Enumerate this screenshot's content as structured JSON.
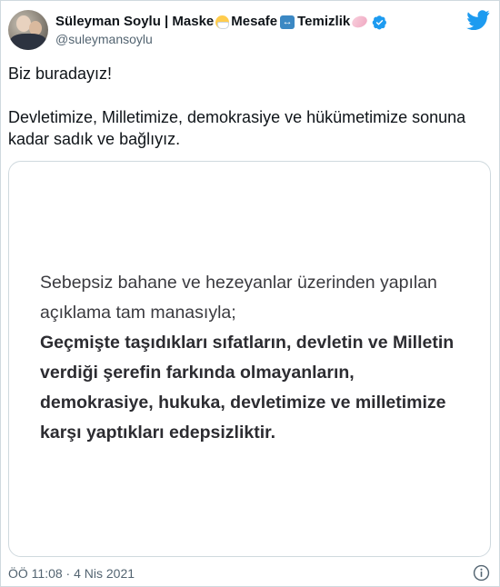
{
  "author": {
    "name_parts": [
      "Süleyman Soylu | Maske",
      "Mesafe",
      "Temizlik"
    ],
    "emoji": [
      "face-with-medical-mask",
      "left-right-arrow",
      "soap"
    ],
    "verified": true,
    "handle": "@suleymansoylu"
  },
  "brand": {
    "icon": "twitter-bird-icon",
    "color": "#1d9bf0"
  },
  "tweet": {
    "line1": "Biz buradayız!",
    "line2": "Devletimize, Milletimize, demokrasiye ve hükümetimize sonuna kadar sadık ve bağlıyız."
  },
  "media": {
    "normal_text": "Sebepsiz bahane ve hezeyanlar üzerinden yapılan açıklama tam manasıyla;",
    "bold_text": "Geçmişte taşıdıkları sıfatların, devletin ve Milletin verdiği şerefin farkında olmayanların, demokrasiye, hukuka, devletimize ve milletimize karşı yaptıkları edepsizliktir."
  },
  "footer": {
    "timestamp": "ÖÖ 11:08 · 4 Nis 2021",
    "info_icon": "info-icon"
  }
}
